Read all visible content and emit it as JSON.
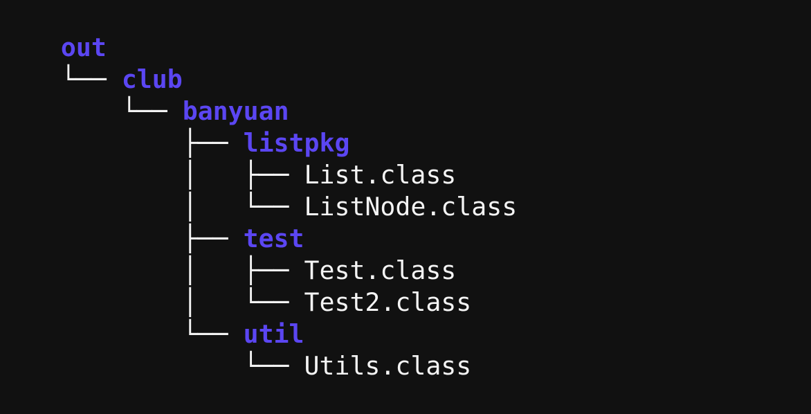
{
  "tree": {
    "lines": [
      {
        "prefix": "",
        "name": "out",
        "kind": "dir"
      },
      {
        "prefix": "└── ",
        "name": "club",
        "kind": "dir"
      },
      {
        "prefix": "    └── ",
        "name": "banyuan",
        "kind": "dir"
      },
      {
        "prefix": "        ├── ",
        "name": "listpkg",
        "kind": "dir"
      },
      {
        "prefix": "        │   ├── ",
        "name": "List.class",
        "kind": "file"
      },
      {
        "prefix": "        │   └── ",
        "name": "ListNode.class",
        "kind": "file"
      },
      {
        "prefix": "        ├── ",
        "name": "test",
        "kind": "dir"
      },
      {
        "prefix": "        │   ├── ",
        "name": "Test.class",
        "kind": "file"
      },
      {
        "prefix": "        │   └── ",
        "name": "Test2.class",
        "kind": "file"
      },
      {
        "prefix": "        └── ",
        "name": "util",
        "kind": "dir"
      },
      {
        "prefix": "            └── ",
        "name": "Utils.class",
        "kind": "file"
      }
    ]
  },
  "colors": {
    "background": "#111111",
    "directory": "#5b46f2",
    "file": "#f4f4f4",
    "branches": "#f2f2f2"
  }
}
